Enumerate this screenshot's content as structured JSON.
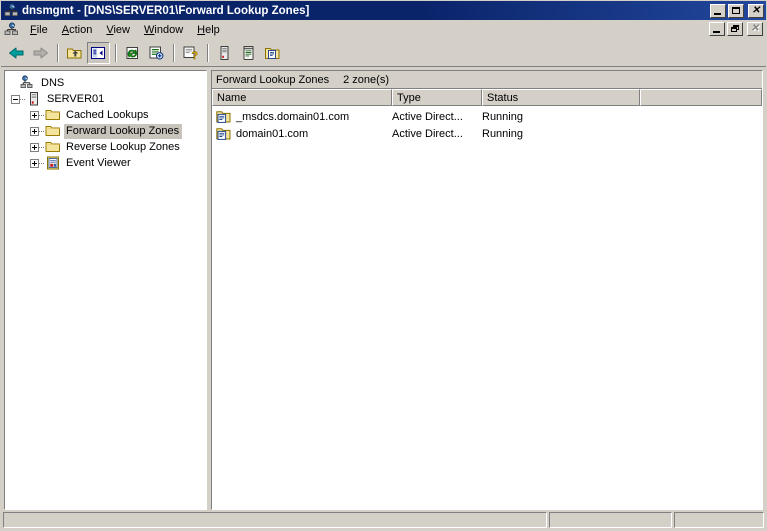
{
  "window": {
    "title": "dnsmgmt - [DNS\\SERVER01\\Forward Lookup Zones]",
    "icon": "mmc-console-icon",
    "controls": {
      "minimize": "_",
      "maximize": "□",
      "close": "✕"
    },
    "child_controls": {
      "minimize": "_",
      "restore": "❐",
      "close": "✕"
    }
  },
  "menu": {
    "system_icon": "mmc-console-icon",
    "items": [
      {
        "label": "File",
        "accel": "F"
      },
      {
        "label": "Action",
        "accel": "A"
      },
      {
        "label": "View",
        "accel": "V"
      },
      {
        "label": "Window",
        "accel": "W"
      },
      {
        "label": "Help",
        "accel": "H"
      }
    ]
  },
  "toolbar": {
    "buttons": [
      {
        "name": "back-icon",
        "title": "Back",
        "enabled": true,
        "pressed": false
      },
      {
        "name": "forward-icon",
        "title": "Forward",
        "enabled": false,
        "pressed": false
      },
      {
        "name": "up-folder-icon",
        "title": "Up One Level",
        "enabled": true,
        "pressed": false
      },
      {
        "name": "show-tree-icon",
        "title": "Show/Hide Tree",
        "enabled": true,
        "pressed": true
      },
      {
        "name": "refresh-icon",
        "title": "Refresh",
        "enabled": true,
        "pressed": false
      },
      {
        "name": "export-list-icon",
        "title": "Export List",
        "enabled": true,
        "pressed": false
      },
      {
        "name": "help-icon",
        "title": "Help",
        "enabled": true,
        "pressed": false
      },
      {
        "name": "server-icon",
        "title": "Server",
        "enabled": true,
        "pressed": false
      },
      {
        "name": "list-icon",
        "title": "List",
        "enabled": true,
        "pressed": false
      },
      {
        "name": "new-zone-icon",
        "title": "New Zone",
        "enabled": true,
        "pressed": false
      }
    ]
  },
  "tree": {
    "nodes": [
      {
        "label": "DNS",
        "icon": "dns-console-icon",
        "level": 0,
        "expander": "none",
        "selected": false
      },
      {
        "label": "SERVER01",
        "icon": "server-icon",
        "level": 1,
        "expander": "minus",
        "selected": false
      },
      {
        "label": "Cached Lookups",
        "icon": "folder-icon",
        "level": 2,
        "expander": "plus",
        "selected": false
      },
      {
        "label": "Forward Lookup Zones",
        "icon": "folder-icon",
        "level": 2,
        "expander": "plus",
        "selected": true
      },
      {
        "label": "Reverse Lookup Zones",
        "icon": "folder-icon",
        "level": 2,
        "expander": "plus",
        "selected": false
      },
      {
        "label": "Event Viewer",
        "icon": "event-viewer-icon",
        "level": 2,
        "expander": "plus",
        "selected": false
      }
    ]
  },
  "list": {
    "caption_title": "Forward Lookup Zones",
    "caption_count": "2 zone(s)",
    "columns": [
      {
        "label": "Name",
        "width": 180
      },
      {
        "label": "Type",
        "width": 90
      },
      {
        "label": "Status",
        "width": 158
      },
      {
        "label": "",
        "width": 129
      }
    ],
    "rows": [
      {
        "icon": "zone-icon",
        "name": "_msdcs.domain01.com",
        "type": "Active Direct...",
        "status": "Running"
      },
      {
        "icon": "zone-icon",
        "name": "domain01.com",
        "type": "Active Direct...",
        "status": "Running"
      }
    ]
  },
  "statusbar": {
    "pane1": "",
    "pane2": "",
    "pane3": ""
  },
  "colors": {
    "titlebar_start": "#0a246a",
    "titlebar_end": "#22479c",
    "face": "#d4d0c8",
    "shadow": "#808080",
    "highlight": "#ffffff",
    "selection_inactive": "#c8c4bc",
    "folder_yellow": "#f5e49b",
    "folder_edge": "#c0a000",
    "white": "#ffffff"
  }
}
